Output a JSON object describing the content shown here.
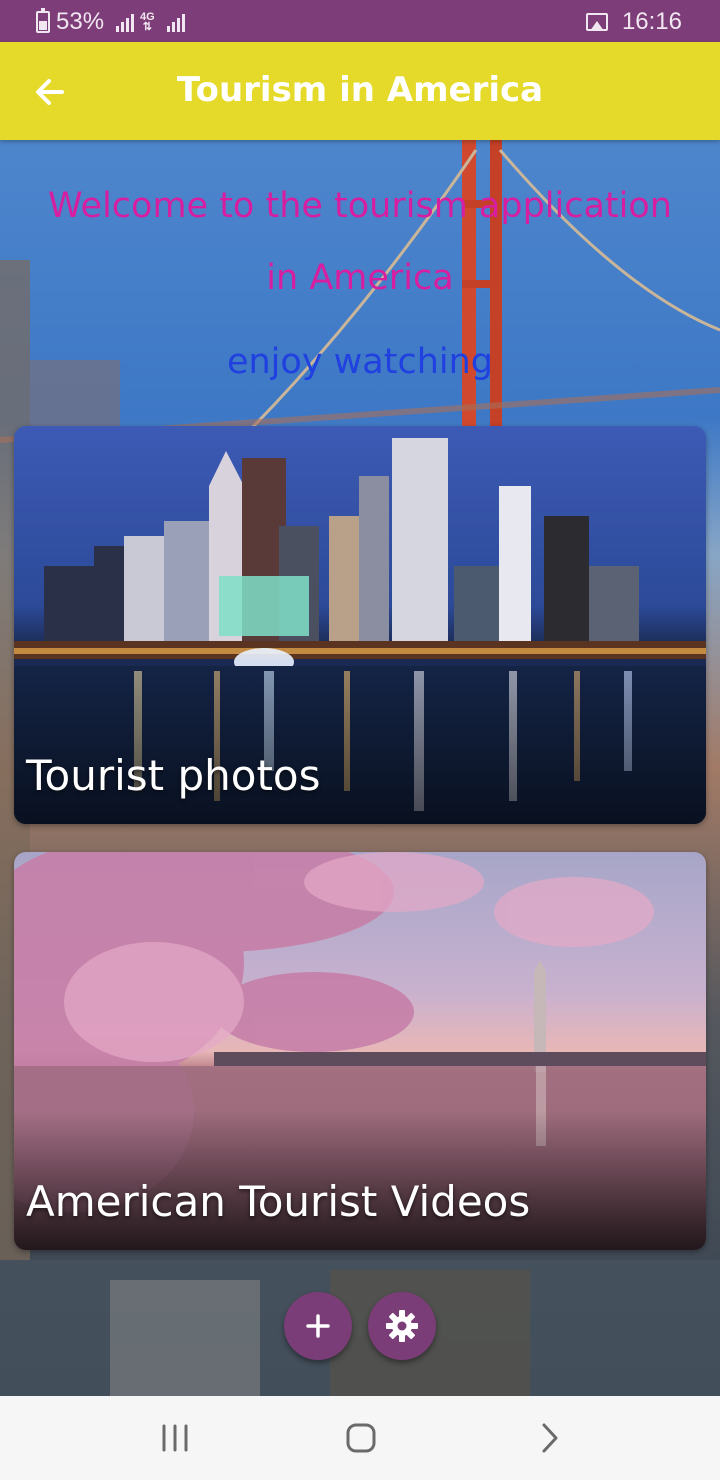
{
  "status_bar": {
    "battery_percent": "53%",
    "network_type": "4G",
    "time": "16:16",
    "icons": [
      "battery-icon",
      "signal-icon",
      "lte-icon",
      "signal-icon",
      "gallery-icon"
    ]
  },
  "app_bar": {
    "title": "Tourism in America",
    "back_icon": "arrow-left-icon",
    "background_color": "#e5d929"
  },
  "main": {
    "welcome_text": "Welcome to the tourism application in America",
    "welcome_color": "#d81ea0",
    "subtitle": "enjoy watching",
    "subtitle_color": "#2040e0",
    "cards": [
      {
        "label": "Tourist photos"
      },
      {
        "label": "American Tourist Videos"
      }
    ]
  },
  "fabs": {
    "add_icon": "plus-icon",
    "settings_icon": "gear-icon",
    "color": "#7b3d78"
  },
  "nav_bar": {
    "icons": [
      "recents-icon",
      "home-icon",
      "back-chevron-icon"
    ]
  }
}
